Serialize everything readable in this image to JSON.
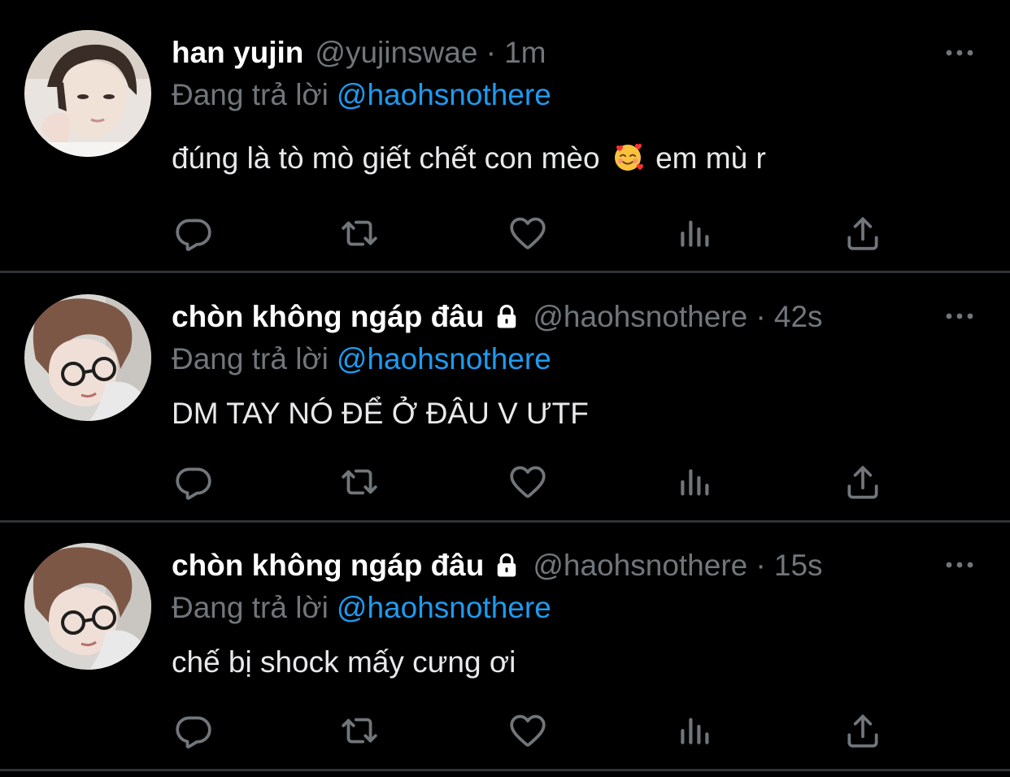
{
  "colors": {
    "background": "#000000",
    "divider": "#2f3336",
    "primary_text": "#e7e9ea",
    "secondary_text": "#71767b",
    "accent": "#1d9bf0"
  },
  "tweets": [
    {
      "display_name": "han yujin",
      "locked": false,
      "handle": "@yujinswae",
      "separator": "·",
      "time": "1m",
      "reply_prefix": "Đang trả lời",
      "reply_mention": "@haohsnothere",
      "text_before_emoji": "đúng là tò mò giết chết con mèo",
      "emoji": "smiling-face-with-hearts",
      "text_after_emoji": "em mù r"
    },
    {
      "display_name": "chòn không ngáp đâu",
      "locked": true,
      "handle": "@haohsnothere",
      "separator": "·",
      "time": "42s",
      "reply_prefix": "Đang trả lời",
      "reply_mention": "@haohsnothere",
      "text": "DM TAY NÓ ĐỂ Ở ĐÂU V ƯTF"
    },
    {
      "display_name": "chòn không ngáp đâu",
      "locked": true,
      "handle": "@haohsnothere",
      "separator": "·",
      "time": "15s",
      "reply_prefix": "Đang trả lời",
      "reply_mention": "@haohsnothere",
      "text": "chế bị shock mấy cưng ơi"
    }
  ],
  "icons": {
    "more": "more-horizontal-icon",
    "reply": "reply-bubble-icon",
    "retweet": "retweet-icon",
    "like": "heart-icon",
    "views": "views-bar-chart-icon",
    "share": "share-upload-icon",
    "lock": "lock-icon"
  }
}
